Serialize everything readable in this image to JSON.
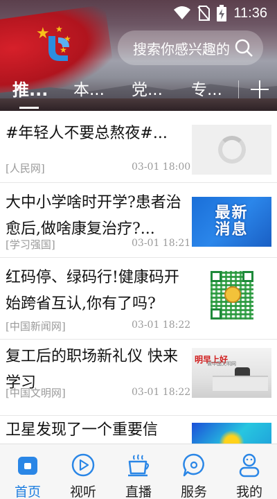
{
  "status_bar": {
    "time": "11:36",
    "icons": [
      "wifi-icon",
      "no-sim-icon",
      "battery-charging-icon"
    ]
  },
  "header": {
    "search_placeholder": "搜索你感兴趣的",
    "tabs": [
      {
        "label": "推...",
        "active": true
      },
      {
        "label": "本...",
        "active": false
      },
      {
        "label": "党...",
        "active": false
      },
      {
        "label": "专...",
        "active": false
      }
    ],
    "add_tab_icon": "plus-icon"
  },
  "feed": [
    {
      "title": "#年轻人不要总熬夜#...",
      "source": "[人民网]",
      "time": "03-01 18:00",
      "thumb": "loading"
    },
    {
      "title": "大中小学啥时开学?患者治愈后,做啥康复治疗?...",
      "source": "[学习强国]",
      "time": "03-01 18:21",
      "thumb": "news",
      "thumb_text": [
        "最新",
        "消息"
      ]
    },
    {
      "title": "红码停、绿码行!健康码开始跨省互认,你有了吗?",
      "source": "[中国新闻网]",
      "time": "03-01 18:22",
      "thumb": "qr"
    },
    {
      "title": "复工后的职场新礼仪 快来学习",
      "source": "[中国文明网]",
      "time": "03-01 18:22",
      "thumb": "office",
      "thumb_text": [
        "明早上好",
        "做中国文明网"
      ]
    },
    {
      "title": "卫星发现了一个重要信",
      "source": "",
      "time": "",
      "thumb": "heatmap"
    }
  ],
  "bottom_nav": [
    {
      "label": "首页",
      "icon": "home-icon",
      "active": true
    },
    {
      "label": "视听",
      "icon": "play-icon",
      "active": false
    },
    {
      "label": "直播",
      "icon": "coffee-cup-icon",
      "active": false
    },
    {
      "label": "服务",
      "icon": "service-chat-icon",
      "active": false
    },
    {
      "label": "我的",
      "icon": "profile-icon",
      "active": false
    }
  ],
  "colors": {
    "accent": "#1e7ee0",
    "text": "#111111",
    "meta": "#9a9a9a"
  }
}
